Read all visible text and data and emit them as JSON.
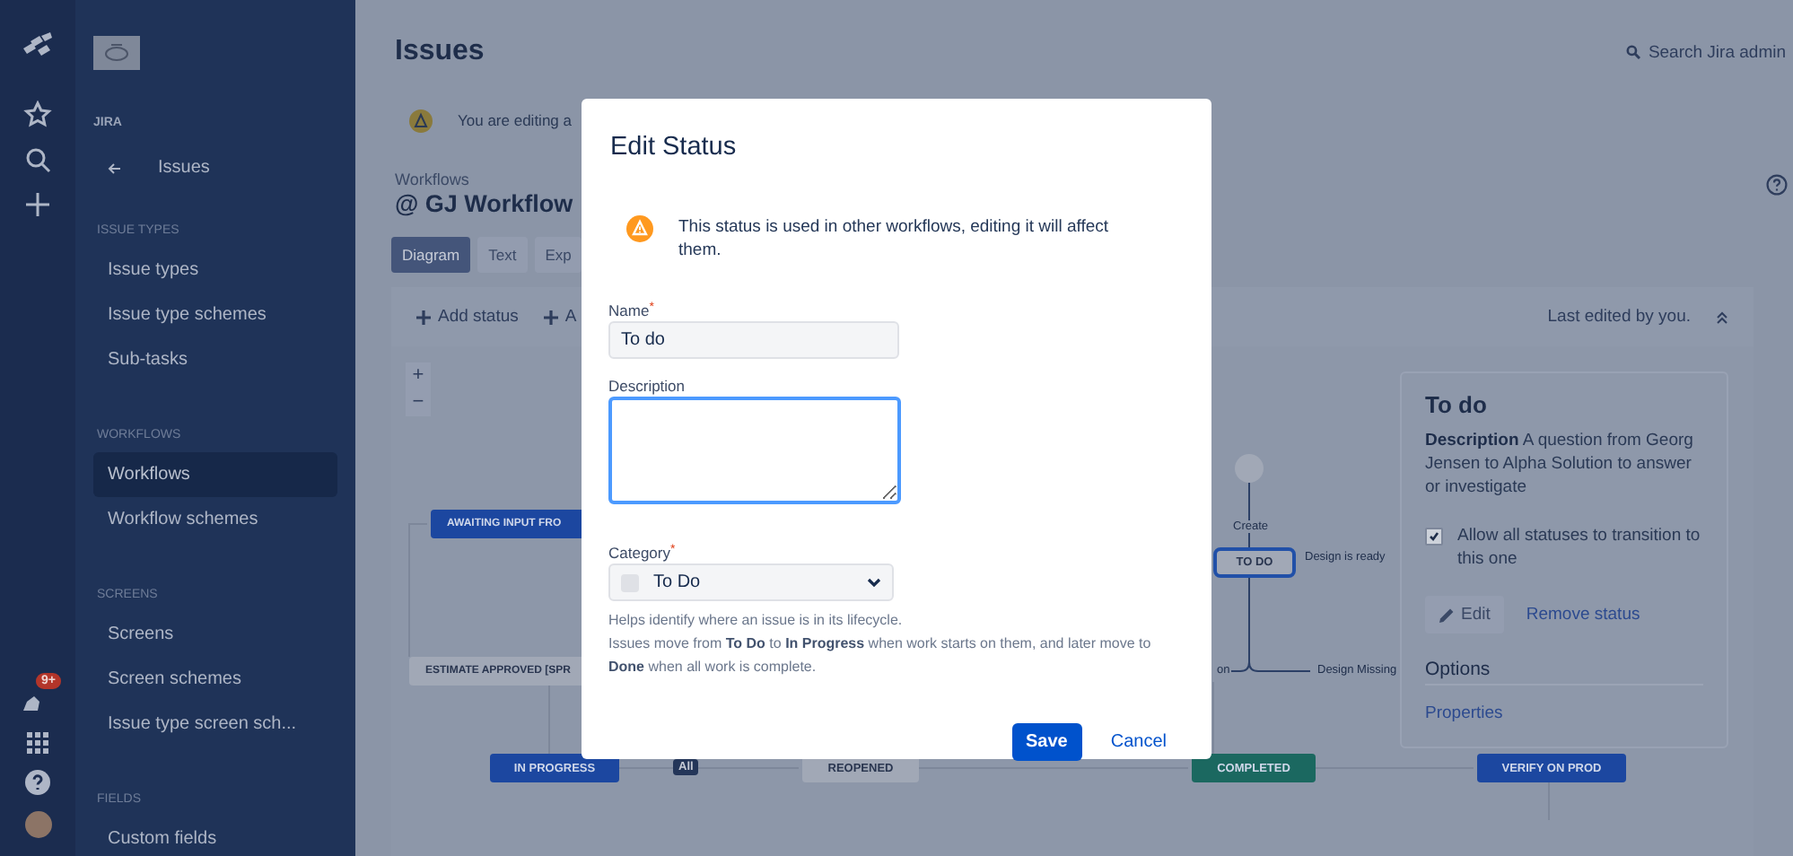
{
  "global_nav": {
    "notifications_badge": "9+"
  },
  "sidebar": {
    "product": "JIRA",
    "back_label": "Issues",
    "sections": [
      {
        "title": "ISSUE TYPES",
        "items": [
          {
            "label": "Issue types",
            "selected": false
          },
          {
            "label": "Issue type schemes",
            "selected": false
          },
          {
            "label": "Sub-tasks",
            "selected": false
          }
        ]
      },
      {
        "title": "WORKFLOWS",
        "items": [
          {
            "label": "Workflows",
            "selected": true
          },
          {
            "label": "Workflow schemes",
            "selected": false
          }
        ]
      },
      {
        "title": "SCREENS",
        "items": [
          {
            "label": "Screens",
            "selected": false
          },
          {
            "label": "Screen schemes",
            "selected": false
          },
          {
            "label": "Issue type screen sch...",
            "selected": false
          }
        ]
      },
      {
        "title": "FIELDS",
        "items": [
          {
            "label": "Custom fields",
            "selected": false
          }
        ]
      }
    ]
  },
  "header": {
    "title": "Issues",
    "search_placeholder": "Search Jira admin"
  },
  "banner": {
    "text": "You are editing a"
  },
  "breadcrumb": "Workflows",
  "workflow_title": "@ GJ Workflow",
  "view_tabs": [
    {
      "label": "Diagram",
      "selected": true
    },
    {
      "label": "Text",
      "selected": false
    },
    {
      "label": "Exp",
      "selected": false
    }
  ],
  "toolbar": {
    "buttons": [
      "Add status",
      "A"
    ],
    "last_edited": "Last edited by you."
  },
  "diagram": {
    "zoom_in": "+",
    "zoom_out": "−",
    "nodes": [
      {
        "label": "AWAITING INPUT FRO",
        "color": "#1c47a0",
        "selected": false
      },
      {
        "label": "ESTIMATE APPROVED [SPR",
        "color": "#a1a8b6",
        "selected": false
      },
      {
        "label": "IN PROGRESS",
        "color": "#1c47a0",
        "selected": false
      },
      {
        "label": "REOPENED",
        "color": "#a1a8b6",
        "selected": false
      },
      {
        "label": "COMPLETED",
        "color": "#1b6860",
        "selected": false
      },
      {
        "label": "VERIFY ON PROD",
        "color": "#1c47a0",
        "selected": false
      },
      {
        "label": "TO DO",
        "color": "#a1a8b6",
        "selected": true
      }
    ],
    "transition_labels": [
      {
        "label": "All",
        "kind": "global"
      },
      {
        "label": "Create",
        "kind": "plain"
      },
      {
        "label": "Design is ready",
        "kind": "plain"
      },
      {
        "label": "on",
        "kind": "plain"
      },
      {
        "label": "Design Missing",
        "kind": "plain"
      }
    ]
  },
  "status_panel": {
    "title": "To do",
    "description": "**Description** A question from Georg Jensen to Alpha Solution to answer or investigate",
    "allow_all": {
      "label": "Allow all statuses to transition to this one",
      "checked": true
    },
    "edit": "Edit",
    "remove": "Remove status",
    "options_title": "Options",
    "properties": "Properties"
  },
  "modal": {
    "title": "Edit Status",
    "warning": "This status is used in other workflows, editing it will affect them.",
    "fields": [
      {
        "kind": "text",
        "label": "Name",
        "required_mark": "*",
        "value": "To do",
        "focused": false
      },
      {
        "kind": "textarea",
        "label": "Description",
        "focused": true
      },
      {
        "kind": "select",
        "label": "Category",
        "required_mark": "*",
        "value": "To Do",
        "focused": false
      }
    ],
    "help": [
      "Helps identify where an issue is in its lifecycle.",
      "Issues move from **To Do** to **In Progress** when work starts on them, and later move to **Done** when all work is complete."
    ],
    "buttons": [
      {
        "label": "Save",
        "kind": "primary"
      },
      {
        "label": "Cancel",
        "kind": "link"
      }
    ]
  }
}
